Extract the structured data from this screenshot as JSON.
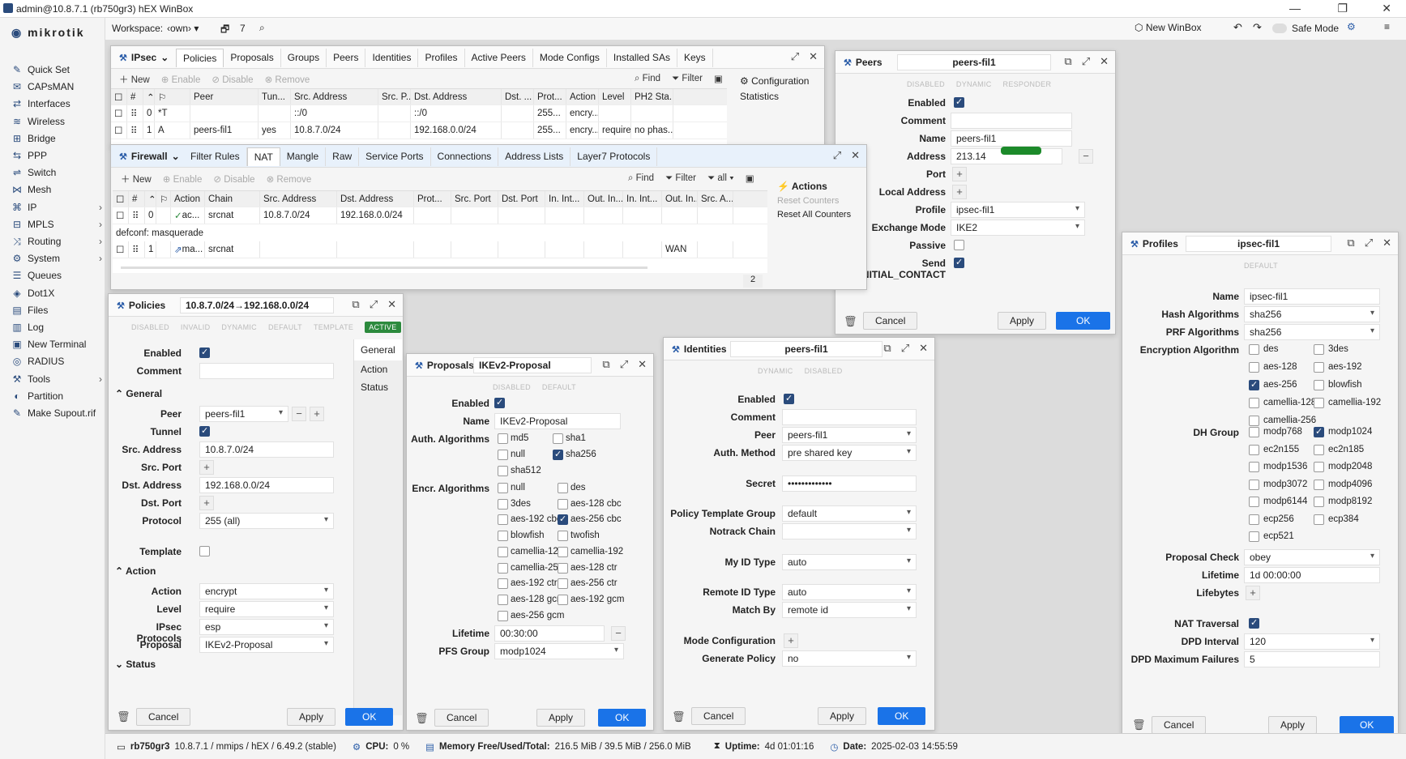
{
  "app": {
    "title": "admin@10.8.7.1 (rb750gr3) hEX WinBox",
    "logo": "MikroTik"
  },
  "sidebar": {
    "items": [
      {
        "label": "Quick Set",
        "icon": "wand-icon",
        "sub": false
      },
      {
        "label": "CAPsMAN",
        "icon": "capsman-icon",
        "sub": false
      },
      {
        "label": "Interfaces",
        "icon": "interfaces-icon",
        "sub": false
      },
      {
        "label": "Wireless",
        "icon": "wireless-icon",
        "sub": false
      },
      {
        "label": "Bridge",
        "icon": "bridge-icon",
        "sub": false
      },
      {
        "label": "PPP",
        "icon": "ppp-icon",
        "sub": false
      },
      {
        "label": "Switch",
        "icon": "switch-icon",
        "sub": false
      },
      {
        "label": "Mesh",
        "icon": "mesh-icon",
        "sub": false
      },
      {
        "label": "IP",
        "icon": "ip-icon",
        "sub": true
      },
      {
        "label": "MPLS",
        "icon": "mpls-icon",
        "sub": true
      },
      {
        "label": "Routing",
        "icon": "routing-icon",
        "sub": true
      },
      {
        "label": "System",
        "icon": "system-icon",
        "sub": true
      },
      {
        "label": "Queues",
        "icon": "queues-icon",
        "sub": false
      },
      {
        "label": "Dot1X",
        "icon": "dot1x-icon",
        "sub": false
      },
      {
        "label": "Files",
        "icon": "files-icon",
        "sub": false
      },
      {
        "label": "Log",
        "icon": "log-icon",
        "sub": false
      },
      {
        "label": "New Terminal",
        "icon": "terminal-icon",
        "sub": false
      },
      {
        "label": "RADIUS",
        "icon": "radius-icon",
        "sub": false
      },
      {
        "label": "Tools",
        "icon": "tools-icon",
        "sub": true
      },
      {
        "label": "Partition",
        "icon": "partition-icon",
        "sub": false
      },
      {
        "label": "Make Supout.rif",
        "icon": "supout-icon",
        "sub": false
      }
    ]
  },
  "topbar": {
    "workspace_label": "Workspace:",
    "workspace_value": "‹own›",
    "count": "7",
    "new_winbox": "New WinBox",
    "safe_mode": "Safe Mode"
  },
  "status": {
    "board": "rb750gr3",
    "info": "10.8.7.1 / mmips / hEX / 6.49.2 (stable)",
    "cpu_label": "CPU:",
    "cpu": "0 %",
    "mem_label": "Memory Free/Used/Total:",
    "mem": "216.5 MiB / 39.5 MiB / 256.0 MiB",
    "uptime_label": "Uptime:",
    "uptime": "4d 01:01:16",
    "date_label": "Date:",
    "date": "2025-02-03 14:55:59"
  },
  "ipsec": {
    "title": "IPsec",
    "tabs": [
      "Policies",
      "Proposals",
      "Groups",
      "Peers",
      "Identities",
      "Profiles",
      "Active Peers",
      "Mode Configs",
      "Installed SAs",
      "Keys"
    ],
    "toolbar": {
      "new": "New",
      "enable": "Enable",
      "disable": "Disable",
      "remove": "Remove",
      "find": "Find",
      "filter": "Filter"
    },
    "cols": [
      "#",
      "Peer",
      "Tun...",
      "Src. Address",
      "Src. P...",
      "Dst. Address",
      "Dst. ...",
      "Prot...",
      "Action",
      "Level",
      "PH2 Sta..."
    ],
    "rows": [
      [
        "0",
        "*T",
        "",
        "::/0",
        "",
        "::/0",
        "",
        "255...",
        "encry...",
        "",
        ""
      ],
      [
        "1",
        "A",
        "peers-fil1",
        "yes",
        "10.8.7.0/24",
        "",
        "192.168.0.0/24",
        "",
        "255...",
        "encry...",
        "require",
        "no phas..."
      ]
    ],
    "side": [
      "Configuration",
      "Statistics"
    ]
  },
  "firewall": {
    "title": "Firewall",
    "tabs": [
      "Filter Rules",
      "NAT",
      "Mangle",
      "Raw",
      "Service Ports",
      "Connections",
      "Address Lists",
      "Layer7 Protocols"
    ],
    "toolbar": {
      "new": "New",
      "enable": "Enable",
      "disable": "Disable",
      "remove": "Remove",
      "find": "Find",
      "filter": "Filter",
      "all": "all"
    },
    "cols": [
      "#",
      "Action",
      "Chain",
      "Src. Address",
      "Dst. Address",
      "Prot...",
      "Src. Port",
      "Dst. Port",
      "In. Int...",
      "Out. In...",
      "In. Int...",
      "Out. In...",
      "Src. A..."
    ],
    "rows": [
      {
        "n": "0",
        "action": "ac...",
        "chain": "srcnat",
        "src": "10.8.7.0/24",
        "dst": "192.168.0.0/24",
        "outif": ""
      },
      {
        "n": "1",
        "action": "ma...",
        "chain": "srcnat",
        "src": "",
        "dst": "",
        "outif": "WAN"
      }
    ],
    "comment": "defconf: masquerade",
    "count": "2",
    "actions_title": "Actions",
    "reset_counters": "Reset Counters",
    "reset_all": "Reset All Counters"
  },
  "peers": {
    "title": "Peers",
    "name_box": "peers-fil1",
    "flags": [
      "DISABLED",
      "DYNAMIC",
      "RESPONDER"
    ],
    "labels": {
      "enabled": "Enabled",
      "comment": "Comment",
      "name": "Name",
      "address": "Address",
      "port": "Port",
      "local_address": "Local Address",
      "profile": "Profile",
      "exchange_mode": "Exchange Mode",
      "passive": "Passive",
      "send_initial": "Send INITIAL_CONTACT"
    },
    "values": {
      "name": "peers-fil1",
      "address": "213.14",
      "profile": "ipsec-fil1",
      "exchange_mode": "IKE2"
    },
    "cancel": "Cancel",
    "apply": "Apply",
    "ok": "OK"
  },
  "profiles": {
    "title": "Profiles",
    "name_box": "ipsec-fil1",
    "flags": [
      "DEFAULT"
    ],
    "labels": {
      "name": "Name",
      "hash": "Hash Algorithms",
      "prf": "PRF Algorithms",
      "enc": "Encryption Algorithm",
      "dh": "DH Group",
      "proposal_check": "Proposal Check",
      "lifetime": "Lifetime",
      "lifebytes": "Lifebytes",
      "nat": "NAT Traversal",
      "dpd": "DPD Interval",
      "dpd_max": "DPD Maximum Failures"
    },
    "values": {
      "name": "ipsec-fil1",
      "hash": "sha256",
      "prf": "sha256",
      "proposal_check": "obey",
      "lifetime": "1d 00:00:00",
      "dpd": "120",
      "dpd_max": "5"
    },
    "enc": [
      [
        "des",
        false
      ],
      [
        "3des",
        false
      ],
      [
        "aes-128",
        false
      ],
      [
        "aes-192",
        false
      ],
      [
        "aes-256",
        true
      ],
      [
        "blowfish",
        false
      ],
      [
        "camellia-128",
        false
      ],
      [
        "camellia-192",
        false
      ],
      [
        "camellia-256",
        false
      ]
    ],
    "dh": [
      [
        "modp768",
        false
      ],
      [
        "modp1024",
        true
      ],
      [
        "ec2n155",
        false
      ],
      [
        "ec2n185",
        false
      ],
      [
        "modp1536",
        false
      ],
      [
        "modp2048",
        false
      ],
      [
        "modp3072",
        false
      ],
      [
        "modp4096",
        false
      ],
      [
        "modp6144",
        false
      ],
      [
        "modp8192",
        false
      ],
      [
        "ecp256",
        false
      ],
      [
        "ecp384",
        false
      ],
      [
        "ecp521",
        false
      ]
    ],
    "cancel": "Cancel",
    "apply": "Apply",
    "ok": "OK"
  },
  "policies": {
    "title": "Policies",
    "name_box": "10.8.7.0/24→192.168.0.0/24",
    "flags": [
      "DISABLED",
      "INVALID",
      "DYNAMIC",
      "DEFAULT",
      "TEMPLATE"
    ],
    "active": "ACTIVE",
    "side": [
      "General",
      "Action",
      "Status"
    ],
    "sections": {
      "general": "General",
      "action": "Action",
      "status": "Status"
    },
    "labels": {
      "enabled": "Enabled",
      "comment": "Comment",
      "peer": "Peer",
      "tunnel": "Tunnel",
      "src": "Src. Address",
      "srcport": "Src. Port",
      "dst": "Dst. Address",
      "dstport": "Dst. Port",
      "protocol": "Protocol",
      "template": "Template",
      "action": "Action",
      "level": "Level",
      "protocols": "IPsec Protocols",
      "proposal": "Proposal"
    },
    "values": {
      "peer": "peers-fil1",
      "src": "10.8.7.0/24",
      "dst": "192.168.0.0/24",
      "protocol": "255 (all)",
      "action": "encrypt",
      "level": "require",
      "protocols": "esp",
      "proposal": "IKEv2-Proposal"
    },
    "cancel": "Cancel",
    "apply": "Apply",
    "ok": "OK"
  },
  "proposals": {
    "title": "Proposals",
    "name_box": "IKEv2-Proposal",
    "flags": [
      "DISABLED",
      "DEFAULT"
    ],
    "labels": {
      "enabled": "Enabled",
      "name": "Name",
      "auth": "Auth. Algorithms",
      "encr": "Encr. Algorithms",
      "lifetime": "Lifetime",
      "pfs": "PFS Group"
    },
    "values": {
      "name": "IKEv2-Proposal",
      "lifetime": "00:30:00",
      "pfs": "modp1024"
    },
    "auth": [
      [
        "md5",
        false
      ],
      [
        "sha1",
        false
      ],
      [
        "null",
        false
      ],
      [
        "sha256",
        true
      ],
      [
        "sha512",
        false
      ]
    ],
    "encr": [
      [
        "null",
        false
      ],
      [
        "des",
        false
      ],
      [
        "3des",
        false
      ],
      [
        "aes-128 cbc",
        false
      ],
      [
        "aes-192 cbc",
        false
      ],
      [
        "aes-256 cbc",
        true
      ],
      [
        "blowfish",
        false
      ],
      [
        "twofish",
        false
      ],
      [
        "camellia-128",
        false
      ],
      [
        "camellia-192",
        false
      ],
      [
        "camellia-256",
        false
      ],
      [
        "aes-128 ctr",
        false
      ],
      [
        "aes-192 ctr",
        false
      ],
      [
        "aes-256 ctr",
        false
      ],
      [
        "aes-128 gcm",
        false
      ],
      [
        "aes-192 gcm",
        false
      ],
      [
        "aes-256 gcm",
        false
      ]
    ],
    "cancel": "Cancel",
    "apply": "Apply",
    "ok": "OK"
  },
  "identities": {
    "title": "Identities",
    "name_box": "peers-fil1",
    "flags": [
      "DYNAMIC",
      "DISABLED"
    ],
    "labels": {
      "enabled": "Enabled",
      "comment": "Comment",
      "peer": "Peer",
      "auth": "Auth. Method",
      "secret": "Secret",
      "ptg": "Policy Template Group",
      "notrack": "Notrack Chain",
      "myid": "My ID Type",
      "remoteid": "Remote ID Type",
      "matchby": "Match By",
      "modeconf": "Mode Configuration",
      "genpol": "Generate Policy"
    },
    "values": {
      "peer": "peers-fil1",
      "auth": "pre shared key",
      "secret": "•••••••••••••",
      "ptg": "default",
      "notrack": "",
      "myid": "auto",
      "remoteid": "auto",
      "matchby": "remote id",
      "genpol": "no"
    },
    "cancel": "Cancel",
    "apply": "Apply",
    "ok": "OK"
  },
  "colors": {
    "accent": "#1a73e8",
    "active": "#2c8a3d",
    "check": "#2a4b7c"
  }
}
